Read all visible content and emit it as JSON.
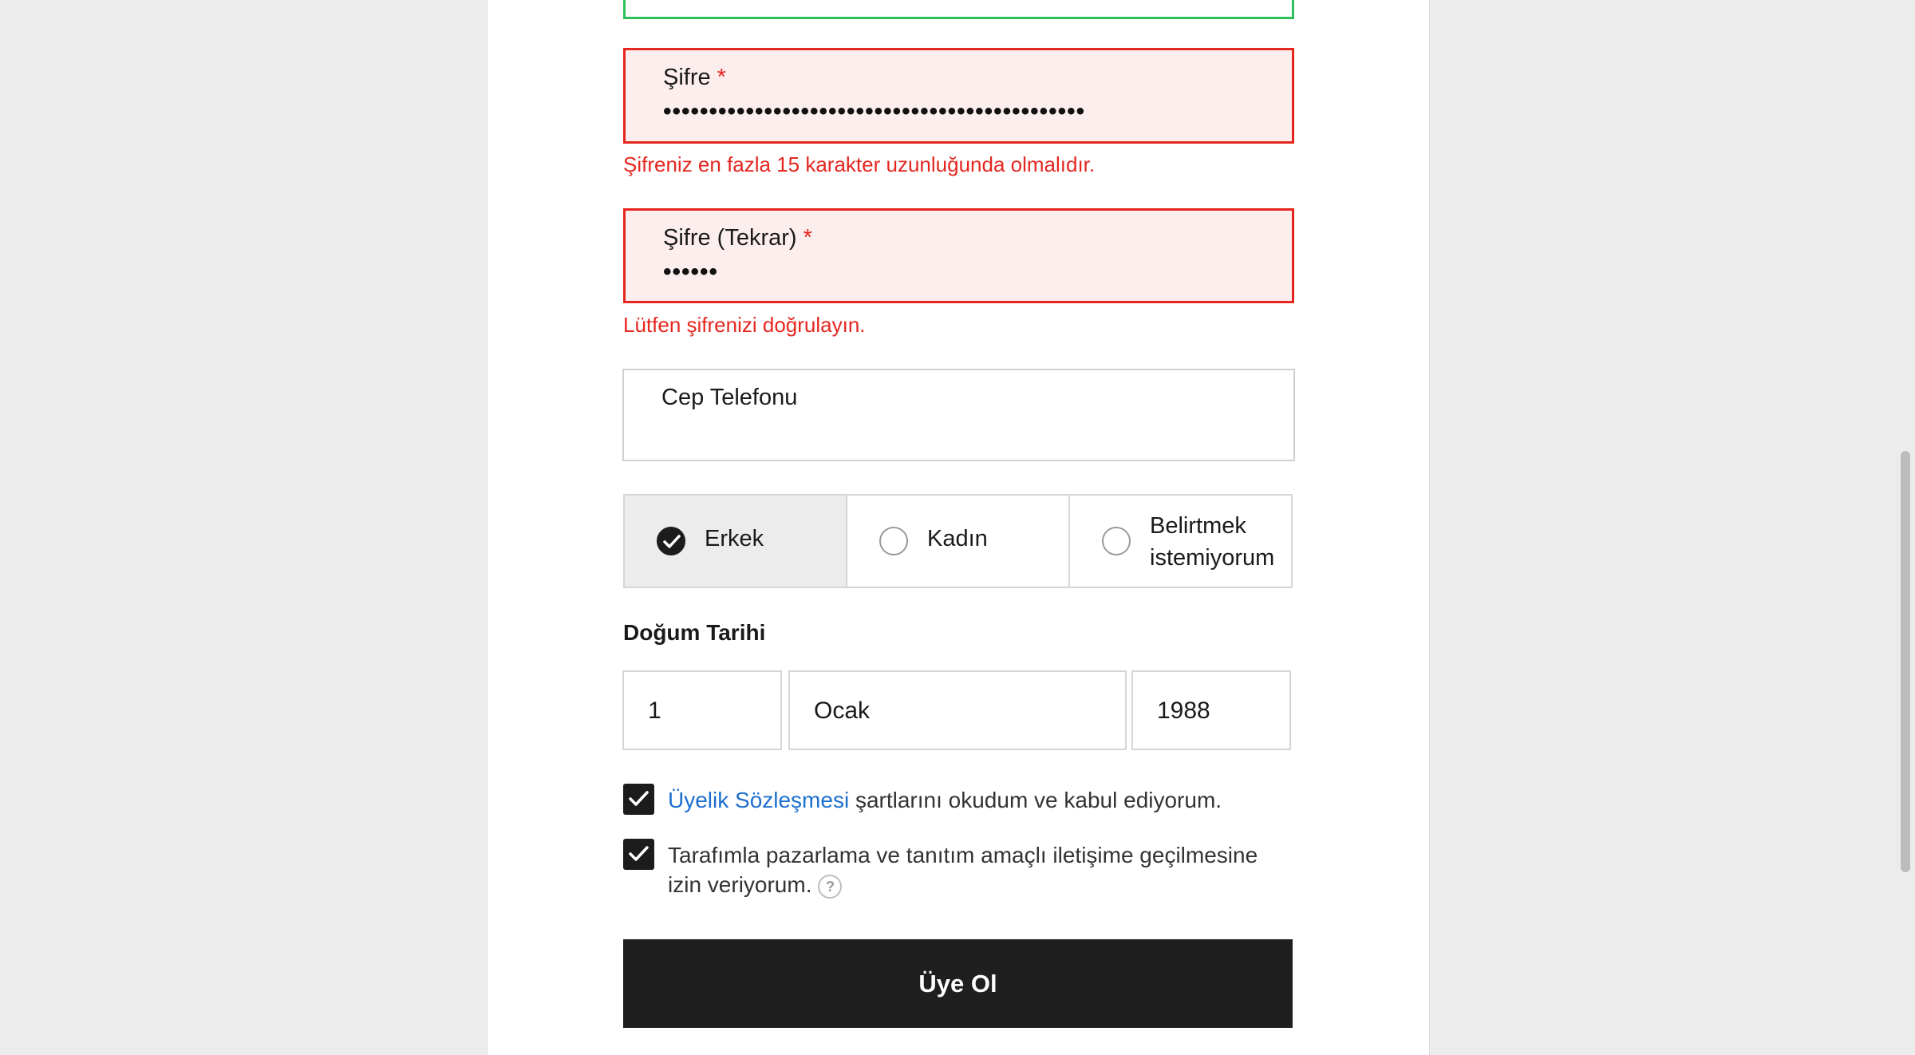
{
  "form": {
    "password": {
      "label": "Şifre",
      "required_mark": "*",
      "value": "••••••••••••••••••••••••••••••••••••••••••••••",
      "error": "Şifreniz en fazla 15 karakter uzunluğunda olmalıdır."
    },
    "password_repeat": {
      "label": "Şifre (Tekrar)",
      "required_mark": "*",
      "value": "••••••",
      "error": "Lütfen şifrenizi doğrulayın."
    },
    "phone": {
      "label": "Cep Telefonu",
      "value": ""
    },
    "gender": {
      "options": [
        {
          "label": "Erkek",
          "selected": true
        },
        {
          "label": "Kadın",
          "selected": false
        },
        {
          "label_line1": "Belirtmek",
          "label_line2": "istemiyorum",
          "selected": false
        }
      ]
    },
    "birth_date": {
      "title": "Doğum Tarihi",
      "day": "1",
      "month": "Ocak",
      "year": "1988"
    },
    "agreement": {
      "link_text": "Üyelik Sözleşmesi",
      "text": " şartlarını okudum ve kabul ediyorum.",
      "checked": true
    },
    "marketing": {
      "text_line1": "Tarafımla pazarlama ve tanıtım amaçlı iletişime geçilmesine",
      "text_line2": "izin veriyorum.",
      "help_symbol": "?",
      "checked": true
    },
    "submit_label": "Üye Ol"
  },
  "colors": {
    "error": "#e5261f",
    "error_bg": "#fdeeee",
    "success": "#2fbf5a",
    "link": "#1d6fd0",
    "button_bg": "#1f1f1f"
  }
}
